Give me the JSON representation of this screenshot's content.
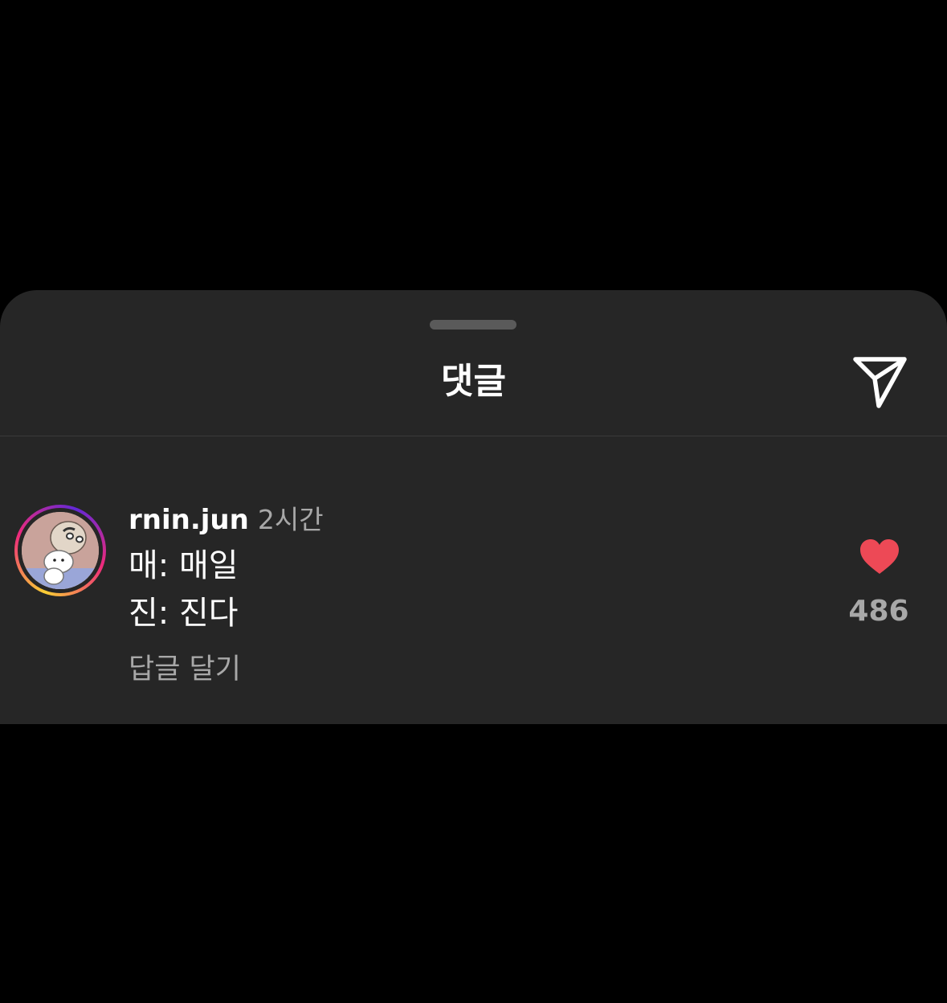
{
  "sheet": {
    "title": "댓글"
  },
  "comment": {
    "username": "rnin.jun",
    "timestamp": "2시간",
    "lines": [
      "매: 매일",
      "진: 진다"
    ],
    "reply_label": "답글 달기",
    "like_count": "486",
    "liked": true
  },
  "icons": {
    "share": "paper-plane-icon",
    "like": "heart-icon",
    "avatar_ring_colors": [
      "#f9ce34",
      "#ee2a7b",
      "#6228d7"
    ]
  },
  "colors": {
    "background": "#000000",
    "sheet": "#262626",
    "text_primary": "#ffffff",
    "text_secondary": "#a8a8a8",
    "heart": "#ed4956"
  }
}
